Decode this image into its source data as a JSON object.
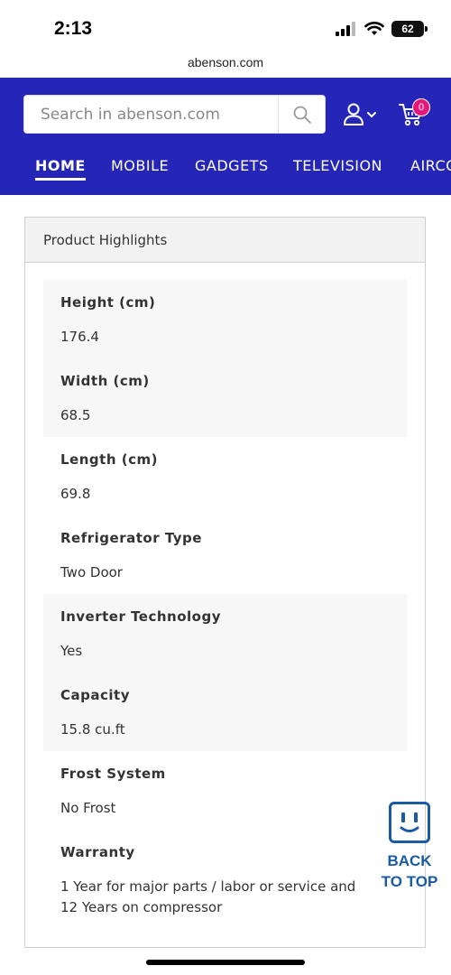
{
  "status_bar": {
    "time": "2:13",
    "battery": "62"
  },
  "browser": {
    "url": "abenson.com"
  },
  "header": {
    "search_placeholder": "Search in abenson.com",
    "cart_count": "0",
    "nav": [
      "HOME",
      "MOBILE",
      "GADGETS",
      "TELEVISION",
      "AIRCO"
    ]
  },
  "highlights": {
    "title": "Product Highlights",
    "specs": [
      {
        "label": "Height (cm)",
        "value": "176.4"
      },
      {
        "label": "Width (cm)",
        "value": "68.5"
      },
      {
        "label": "Length (cm)",
        "value": "69.8"
      },
      {
        "label": "Refrigerator Type",
        "value": "Two Door"
      },
      {
        "label": "Inverter Technology",
        "value": "Yes"
      },
      {
        "label": "Capacity",
        "value": "15.8 cu.ft"
      },
      {
        "label": "Frost System",
        "value": "No Frost"
      },
      {
        "label": "Warranty",
        "value_line1": "1 Year for major parts / labor or service and",
        "value_line2": "12 Years on compressor"
      }
    ]
  },
  "back_to_top": {
    "line1": "BACK",
    "line2": "TO TOP"
  },
  "icons": {
    "search": "search-icon",
    "user": "user-icon",
    "cart": "cart-icon",
    "back_to_top": "plug-face-icon"
  },
  "colors": {
    "header_bg": "#2525b8",
    "badge": "#e6177a",
    "back_to_top": "#1a5aa6"
  }
}
